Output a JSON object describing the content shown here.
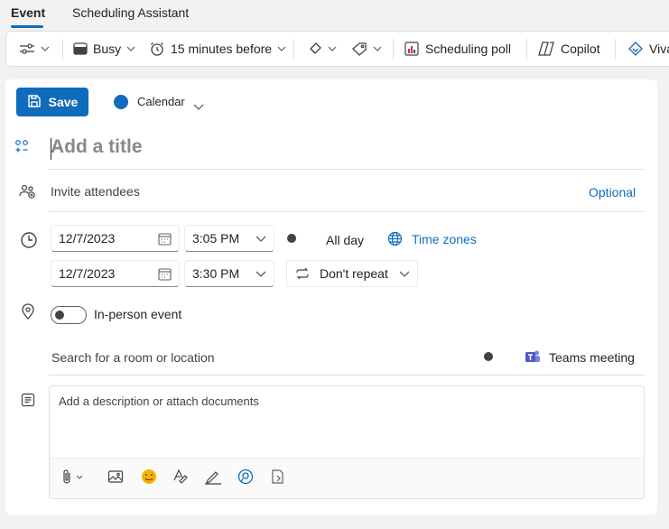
{
  "tabs": [
    {
      "label": "Event",
      "active": true
    },
    {
      "label": "Scheduling Assistant",
      "active": false
    }
  ],
  "toolbar": {
    "availability": "Busy",
    "reminder": "15 minutes before",
    "scheduling_poll": "Scheduling poll",
    "copilot": "Copilot",
    "viva": "Viva"
  },
  "form": {
    "save_label": "Save",
    "calendar_name": "Calendar",
    "title_placeholder": "Add a title",
    "attendees_placeholder": "Invite attendees",
    "optional_label": "Optional",
    "start_date": "12/7/2023",
    "start_time": "3:05 PM",
    "end_date": "12/7/2023",
    "end_time": "3:30 PM",
    "all_day_label": "All day",
    "time_zones_label": "Time zones",
    "repeat_label": "Don't repeat",
    "in_person_label": "In-person event",
    "location_placeholder": "Search for a room or location",
    "teams_label": "Teams meeting",
    "description_placeholder": "Add a description or attach documents"
  },
  "colors": {
    "accent": "#0f6cbd",
    "calendar": "#0f6cbd"
  }
}
